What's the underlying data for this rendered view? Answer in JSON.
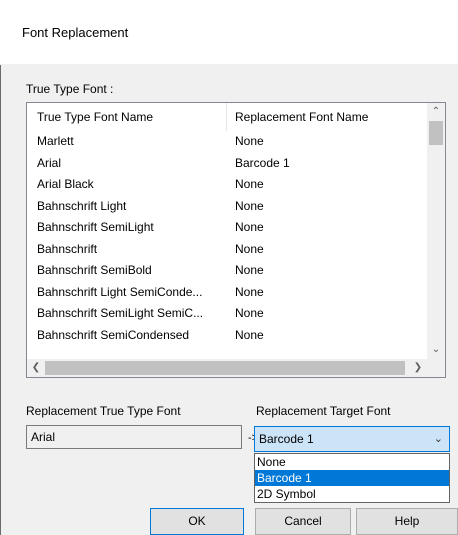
{
  "dialog": {
    "title": "Font Replacement"
  },
  "list": {
    "group_label": "True Type Font :",
    "columns": [
      "True Type Font Name",
      "Replacement Font Name"
    ],
    "rows": [
      {
        "name": "Marlett",
        "replacement": "None"
      },
      {
        "name": "Arial",
        "replacement": "Barcode 1"
      },
      {
        "name": "Arial Black",
        "replacement": "None"
      },
      {
        "name": "Bahnschrift Light",
        "replacement": "None"
      },
      {
        "name": "Bahnschrift SemiLight",
        "replacement": "None"
      },
      {
        "name": "Bahnschrift",
        "replacement": "None"
      },
      {
        "name": "Bahnschrift SemiBold",
        "replacement": "None"
      },
      {
        "name": "Bahnschrift Light SemiConde...",
        "replacement": "None"
      },
      {
        "name": "Bahnschrift SemiLight SemiC...",
        "replacement": "None"
      },
      {
        "name": "Bahnschrift SemiCondensed",
        "replacement": "None"
      }
    ],
    "scroll_icons": {
      "up": "chevron-up-icon",
      "down": "chevron-down-icon",
      "left": "chevron-left-icon",
      "right": "chevron-right-icon"
    }
  },
  "replacement": {
    "source_label": "Replacement True Type Font",
    "source_value": "Arial",
    "arrow": "->",
    "target_label": "Replacement Target Font",
    "target_value": "Barcode 1",
    "options": [
      "None",
      "Barcode 1",
      "2D Symbol"
    ],
    "selected_index": 1
  },
  "buttons": {
    "ok": "OK",
    "cancel": "Cancel",
    "help": "Help"
  },
  "colors": {
    "accent": "#0078d7",
    "combo_bg": "#cce4f7",
    "dialog_bg": "#f0f0f0"
  }
}
